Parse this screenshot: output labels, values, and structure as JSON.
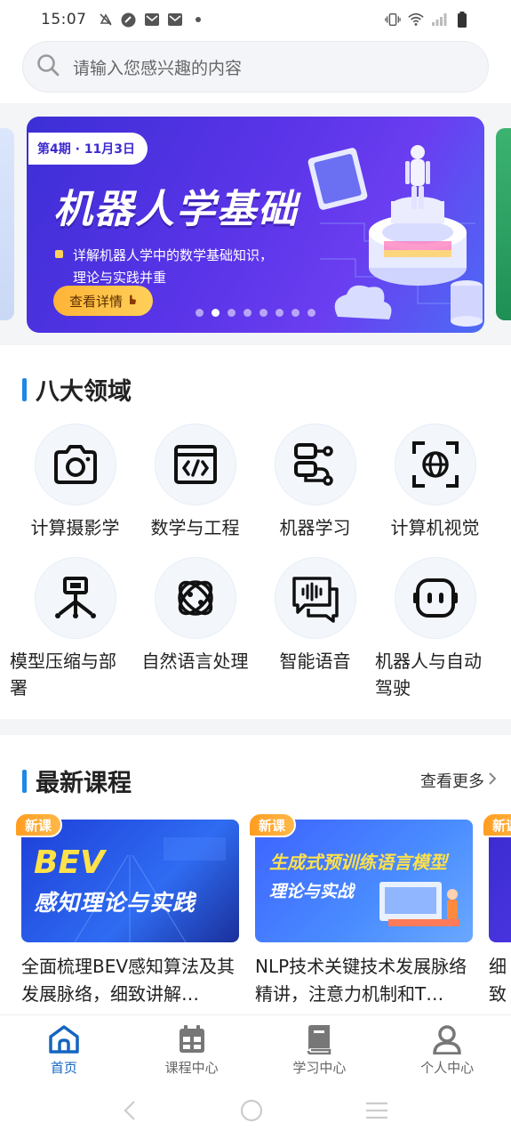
{
  "status_bar": {
    "time": "15:07"
  },
  "search": {
    "placeholder": "请输入您感兴趣的内容"
  },
  "banner": {
    "issue_tag": "第4期 · 11月3日",
    "title": "机器人学基础",
    "desc_line1": "详解机器人学中的数学基础知识，",
    "desc_line2": "理论与实践并重",
    "button_label": "查看详情",
    "dot_count": 8,
    "active_dot": 1
  },
  "domains": {
    "title": "八大领域",
    "items": [
      {
        "label": "计算摄影学",
        "icon": "camera-icon"
      },
      {
        "label": "数学与工程",
        "icon": "code-icon"
      },
      {
        "label": "机器学习",
        "icon": "workflow-icon"
      },
      {
        "label": "计算机视觉",
        "icon": "scan-globe-icon"
      },
      {
        "label": "模型压缩与部署",
        "icon": "deploy-icon"
      },
      {
        "label": "自然语言处理",
        "icon": "atom-icon"
      },
      {
        "label": "智能语音",
        "icon": "voice-chat-icon"
      },
      {
        "label": "机器人与自动驾驶",
        "icon": "robot-icon"
      }
    ]
  },
  "courses": {
    "title": "最新课程",
    "more_label": "查看更多",
    "items": [
      {
        "tag": "新课",
        "thumb_line1": "BEV",
        "thumb_line2": "感知理论与实践",
        "title": "全面梳理BEV感知算法及其发展脉络，细致讲解…"
      },
      {
        "tag": "新课",
        "thumb_line1": "生成式预训练语言模型",
        "thumb_line2": "理论与实战",
        "title": "NLP技术关键技术发展脉络精讲，注意力机制和T…"
      },
      {
        "tag": "新课",
        "title": "细致HD"
      }
    ]
  },
  "tabbar": {
    "tabs": [
      {
        "label": "首页",
        "icon": "home-icon",
        "active": true
      },
      {
        "label": "课程中心",
        "icon": "calendar-icon",
        "active": false
      },
      {
        "label": "学习中心",
        "icon": "book-icon",
        "active": false
      },
      {
        "label": "个人中心",
        "icon": "user-icon",
        "active": false
      }
    ]
  },
  "colors": {
    "accent": "#1e88e5",
    "active_tab": "#1565c0",
    "new_tag": "#ff9d1f"
  }
}
